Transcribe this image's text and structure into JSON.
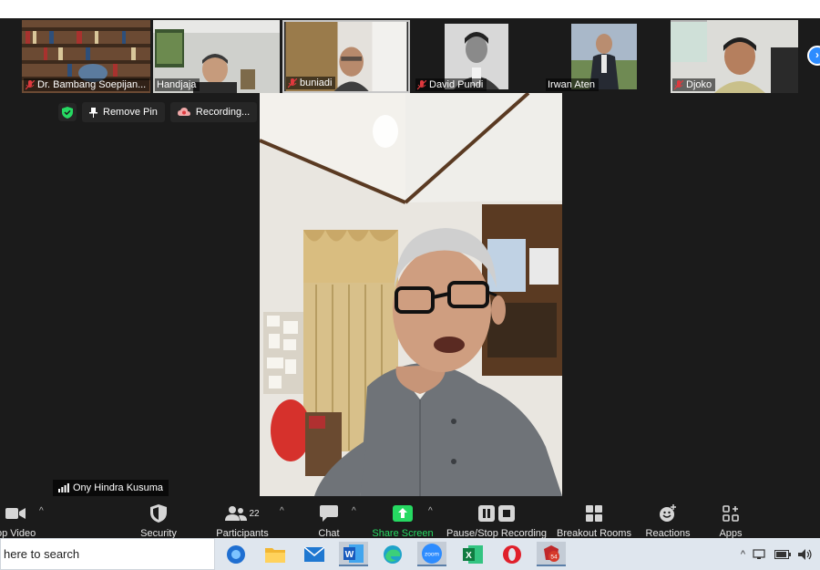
{
  "participants": [
    {
      "name": "Dr. Bambang Soepijan...",
      "muted": true
    },
    {
      "name": "Handjaja",
      "muted": false
    },
    {
      "name": "buniadi",
      "muted": true
    },
    {
      "name": "David Pundi",
      "muted": true
    },
    {
      "name": "Irwan Aten",
      "muted": false
    },
    {
      "name": "Djoko",
      "muted": true
    }
  ],
  "pinbar": {
    "remove_pin": "Remove Pin",
    "recording": "Recording..."
  },
  "active_speaker": {
    "name": "Ony Hindra Kusuma"
  },
  "toolbar": {
    "stop_video": "op Video",
    "security": "Security",
    "participants": "Participants",
    "participants_count": "22",
    "chat": "Chat",
    "share_screen": "Share Screen",
    "pause_stop_recording": "Pause/Stop Recording",
    "breakout_rooms": "Breakout Rooms",
    "reactions": "Reactions",
    "apps": "Apps"
  },
  "taskbar": {
    "search_placeholder": "here to search",
    "zoom_label": "zoom",
    "notification_count": "54"
  },
  "colors": {
    "meeting_bg": "#1b1b1b",
    "accent_blue": "#2d8cff",
    "share_green": "#26d962",
    "mute_red": "#e0393e"
  }
}
